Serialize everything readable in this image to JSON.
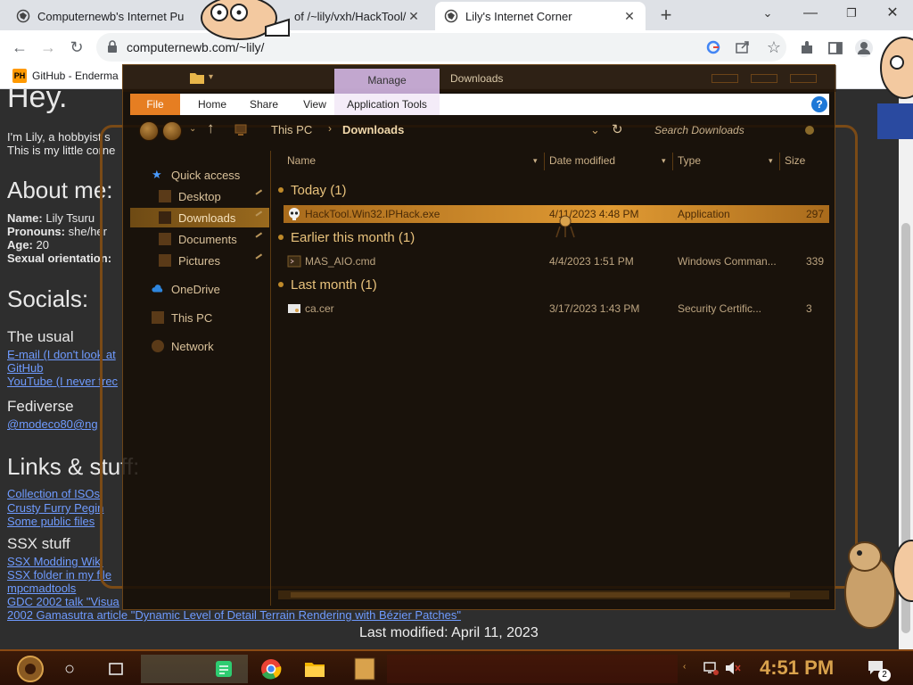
{
  "browser": {
    "tabs": [
      {
        "label": "Computernewb's Internet Pu",
        "active": false
      },
      {
        "label": "of /~lily/vxh/HackTool/",
        "active": false
      },
      {
        "label": "Lily's Internet Corner",
        "active": true
      }
    ],
    "url": "computernewb.com/~lily/",
    "bookmarks": [
      {
        "label": "GitHub - Enderma",
        "badge": "PH"
      }
    ]
  },
  "page": {
    "greeting": "Hey.",
    "intro_line1": "I'm Lily, a hobbyist s",
    "intro_line2": "This is my little corne",
    "about_heading": "About me:",
    "about": [
      {
        "key": "Name:",
        "value": "Lily Tsuru"
      },
      {
        "key": "Pronouns:",
        "value": "she/her"
      },
      {
        "key": "Age:",
        "value": "20"
      },
      {
        "key": "Sexual orientation:",
        "value": ""
      }
    ],
    "socials_heading": "Socials:",
    "usual_heading": "The usual",
    "usual_links": [
      "E-mail (I don't look at",
      "GitHub",
      "YouTube (I never frec"
    ],
    "fediverse_heading": "Fediverse",
    "fediverse_link": "@modeco80@ng",
    "links_heading": "Links & stuff:",
    "links": [
      "Collection of ISOs",
      "Crusty Furry Pegin",
      "Some public files"
    ],
    "ssx_heading": "SSX stuff",
    "ssx_links": [
      "SSX Modding Wiki",
      "SSX folder in my file",
      "mpcmadtools",
      "GDC 2002 talk \"Visua",
      "2002 Gamasutra article \"Dynamic Level of Detail Terrain Rendering with Bézier Patches\""
    ],
    "last_modified": "Last modified: April 11, 2023"
  },
  "explorer": {
    "context_tab": "Manage",
    "window_title": "Downloads",
    "ribbon_tabs": [
      "File",
      "Home",
      "Share",
      "View",
      "Application Tools"
    ],
    "breadcrumb": [
      "This PC",
      "Downloads"
    ],
    "search_placeholder": "Search Downloads",
    "nav": {
      "quick_access": "Quick access",
      "items": [
        "Desktop",
        "Downloads",
        "Documents",
        "Pictures"
      ],
      "onedrive": "OneDrive",
      "this_pc": "This PC",
      "network": "Network"
    },
    "columns": [
      "Name",
      "Date modified",
      "Type",
      "Size"
    ],
    "groups": [
      {
        "label": "Today (1)",
        "files": [
          {
            "name": "HackTool.Win32.IPHack.exe",
            "date": "4/11/2023 4:48 PM",
            "type": "Application",
            "size": "297",
            "selected": true
          }
        ]
      },
      {
        "label": "Earlier this month (1)",
        "files": [
          {
            "name": "MAS_AIO.cmd",
            "date": "4/4/2023 1:51 PM",
            "type": "Windows Comman...",
            "size": "339",
            "selected": false
          }
        ]
      },
      {
        "label": "Last month (1)",
        "files": [
          {
            "name": "ca.cer",
            "date": "3/17/2023 1:43 PM",
            "type": "Security Certific...",
            "size": "3",
            "selected": false
          }
        ]
      }
    ]
  },
  "taskbar": {
    "clock": "4:51 PM",
    "notification_count": "2"
  },
  "colors": {
    "accent_file_tab": "#e67e22",
    "selection": "#e09a33",
    "clock": "#d9a24c",
    "link": "#6f9bff"
  }
}
